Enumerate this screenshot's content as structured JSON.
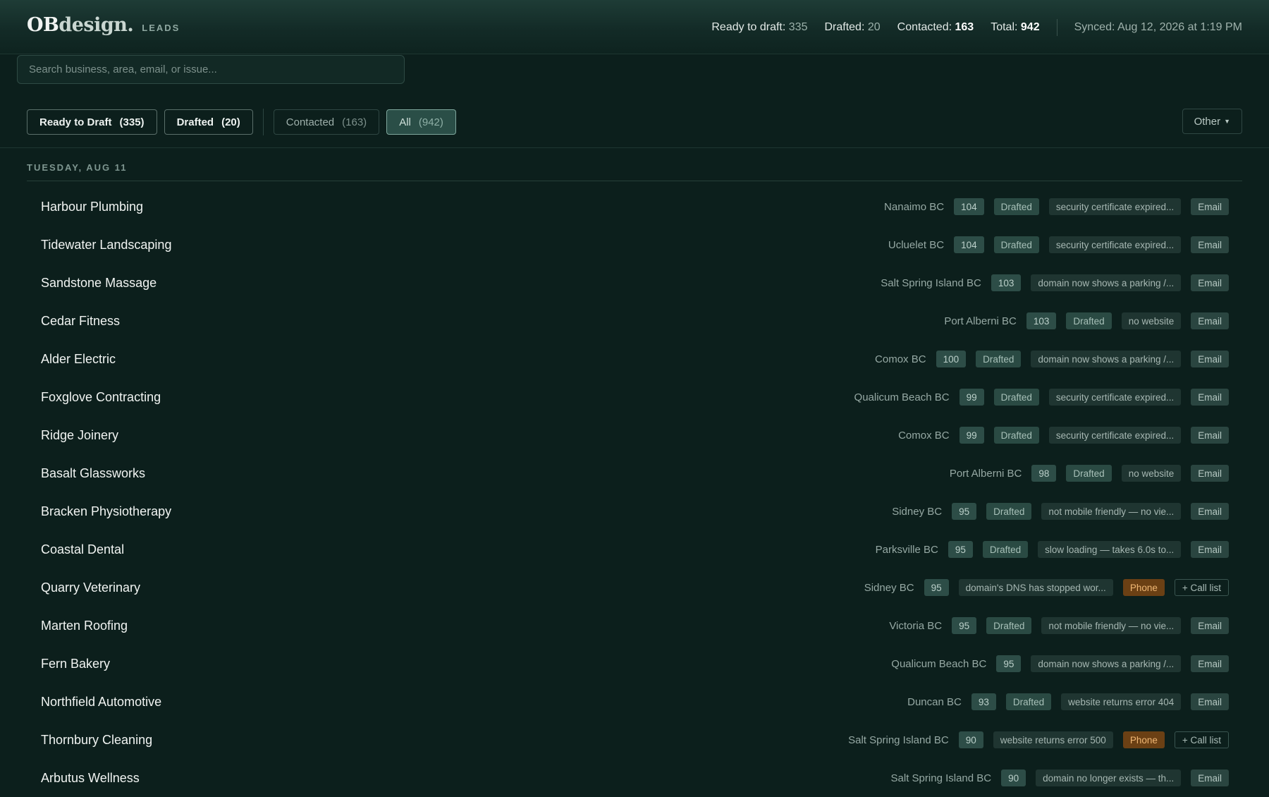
{
  "header": {
    "logo_bold": "OB",
    "logo_rest": "design.",
    "section": "LEADS",
    "stats": [
      {
        "label": "Ready to draft:",
        "value": "335",
        "style": "muted"
      },
      {
        "label": "Drafted:",
        "value": "20",
        "style": "muted"
      },
      {
        "label": "Contacted:",
        "value": "163",
        "style": "strong"
      },
      {
        "label": "Total:",
        "value": "942",
        "style": "strong"
      }
    ],
    "synced": "Synced: Aug 12, 2026 at 1:19 PM"
  },
  "search": {
    "placeholder": "Search business, area, email, or issue...",
    "value": ""
  },
  "filters": [
    {
      "label": "Ready to Draft",
      "count": "(335)"
    },
    {
      "label": "Drafted",
      "count": "(20)"
    },
    {
      "label": "Contacted",
      "count": "(163)"
    },
    {
      "label": "All",
      "count": "(942)"
    }
  ],
  "active_filter": "All",
  "other_button": {
    "label": "Other",
    "icon": "caret-down-icon"
  },
  "day_heading": "TUESDAY, AUG 11",
  "leads": [
    {
      "name": "Harbour Plumbing",
      "location": "Nanaimo BC",
      "score": "104",
      "status": "Drafted",
      "issue": "security certificate expired...",
      "channel": "Email"
    },
    {
      "name": "Tidewater Landscaping",
      "location": "Ucluelet BC",
      "score": "104",
      "status": "Drafted",
      "issue": "security certificate expired...",
      "channel": "Email"
    },
    {
      "name": "Sandstone Massage",
      "location": "Salt Spring Island BC",
      "score": "103",
      "status": "",
      "issue": "domain now shows a parking /...",
      "channel": "Email"
    },
    {
      "name": "Cedar Fitness",
      "location": "Port Alberni BC",
      "score": "103",
      "status": "Drafted",
      "issue": "no website",
      "channel": "Email"
    },
    {
      "name": "Alder Electric",
      "location": "Comox BC",
      "score": "100",
      "status": "Drafted",
      "issue": "domain now shows a parking /...",
      "channel": "Email"
    },
    {
      "name": "Foxglove Contracting",
      "location": "Qualicum Beach BC",
      "score": "99",
      "status": "Drafted",
      "issue": "security certificate expired...",
      "channel": "Email"
    },
    {
      "name": "Ridge Joinery",
      "location": "Comox BC",
      "score": "99",
      "status": "Drafted",
      "issue": "security certificate expired...",
      "channel": "Email"
    },
    {
      "name": "Basalt Glassworks",
      "location": "Port Alberni BC",
      "score": "98",
      "status": "Drafted",
      "issue": "no website",
      "channel": "Email"
    },
    {
      "name": "Bracken Physiotherapy",
      "location": "Sidney BC",
      "score": "95",
      "status": "Drafted",
      "issue": "not mobile friendly — no vie...",
      "channel": "Email"
    },
    {
      "name": "Coastal Dental",
      "location": "Parksville BC",
      "score": "95",
      "status": "Drafted",
      "issue": "slow loading — takes 6.0s to...",
      "channel": "Email"
    },
    {
      "name": "Quarry Veterinary",
      "location": "Sidney BC",
      "score": "95",
      "status": "",
      "issue": "domain's DNS has stopped wor...",
      "channel": "Phone",
      "action": "+ Call list"
    },
    {
      "name": "Marten Roofing",
      "location": "Victoria BC",
      "score": "95",
      "status": "Drafted",
      "issue": "not mobile friendly — no vie...",
      "channel": "Email"
    },
    {
      "name": "Fern Bakery",
      "location": "Qualicum Beach BC",
      "score": "95",
      "status": "",
      "issue": "domain now shows a parking /...",
      "channel": "Email"
    },
    {
      "name": "Northfield Automotive",
      "location": "Duncan BC",
      "score": "93",
      "status": "Drafted",
      "issue": "website returns error 404",
      "channel": "Email"
    },
    {
      "name": "Thornbury Cleaning",
      "location": "Salt Spring Island BC",
      "score": "90",
      "status": "",
      "issue": "website returns error 500",
      "channel": "Phone",
      "action": "+ Call list"
    },
    {
      "name": "Arbutus Wellness",
      "location": "Salt Spring Island BC",
      "score": "90",
      "status": "",
      "issue": "domain no longer exists — th...",
      "channel": "Email"
    }
  ]
}
